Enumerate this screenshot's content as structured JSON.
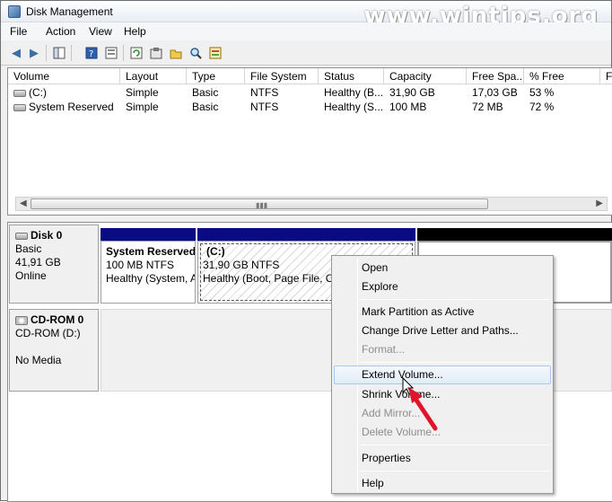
{
  "window": {
    "title": "Disk Management",
    "watermark": "www.wintips.org"
  },
  "menubar": [
    "File",
    "Action",
    "View",
    "Help"
  ],
  "toolbar_icons": [
    "back-arrow-icon",
    "forward-arrow-icon",
    "console-tree-icon",
    "help-icon",
    "properties-icon",
    "refresh-icon",
    "settings-icon",
    "open-icon",
    "search-icon",
    "export-icon"
  ],
  "volume_list": {
    "columns": [
      "Volume",
      "Layout",
      "Type",
      "File System",
      "Status",
      "Capacity",
      "Free Spa...",
      "% Free",
      "F"
    ],
    "rows": [
      {
        "volume": "(C:)",
        "layout": "Simple",
        "type": "Basic",
        "fs": "NTFS",
        "status": "Healthy (B...",
        "capacity": "31,90 GB",
        "free": "17,03 GB",
        "pct": "53 %"
      },
      {
        "volume": "System Reserved",
        "layout": "Simple",
        "type": "Basic",
        "fs": "NTFS",
        "status": "Healthy (S...",
        "capacity": "100 MB",
        "free": "72 MB",
        "pct": "72 %"
      }
    ]
  },
  "disks": [
    {
      "name": "Disk 0",
      "type": "Basic",
      "size": "41,91 GB",
      "state": "Online"
    },
    {
      "name": "CD-ROM 0",
      "type": "CD-ROM (D:)",
      "blank": "",
      "media": "No Media"
    }
  ],
  "partitions": [
    {
      "name": "System Reserved",
      "size": "100 MB NTFS",
      "status": "Healthy (System, A"
    },
    {
      "name": "(C:)",
      "size": "31,90 GB NTFS",
      "status": "Healthy (Boot, Page File, Cra"
    }
  ],
  "colors": {
    "primary_bar": "#0a0a82",
    "unallocated_bar": "#000000",
    "menu_hover": "#e2ecf7",
    "arrow": "#e0142a"
  },
  "context_menu": {
    "items": [
      {
        "label": "Open",
        "enabled": true
      },
      {
        "label": "Explore",
        "enabled": true
      },
      {
        "label": "Mark Partition as Active",
        "enabled": true
      },
      {
        "label": "Change Drive Letter and Paths...",
        "enabled": true
      },
      {
        "label": "Format...",
        "enabled": false
      },
      {
        "label": "Extend Volume...",
        "enabled": true,
        "highlighted": true
      },
      {
        "label": "Shrink Volume...",
        "enabled": true
      },
      {
        "label": "Add Mirror...",
        "enabled": false
      },
      {
        "label": "Delete Volume...",
        "enabled": false
      },
      {
        "label": "Properties",
        "enabled": true
      },
      {
        "label": "Help",
        "enabled": true
      }
    ]
  }
}
